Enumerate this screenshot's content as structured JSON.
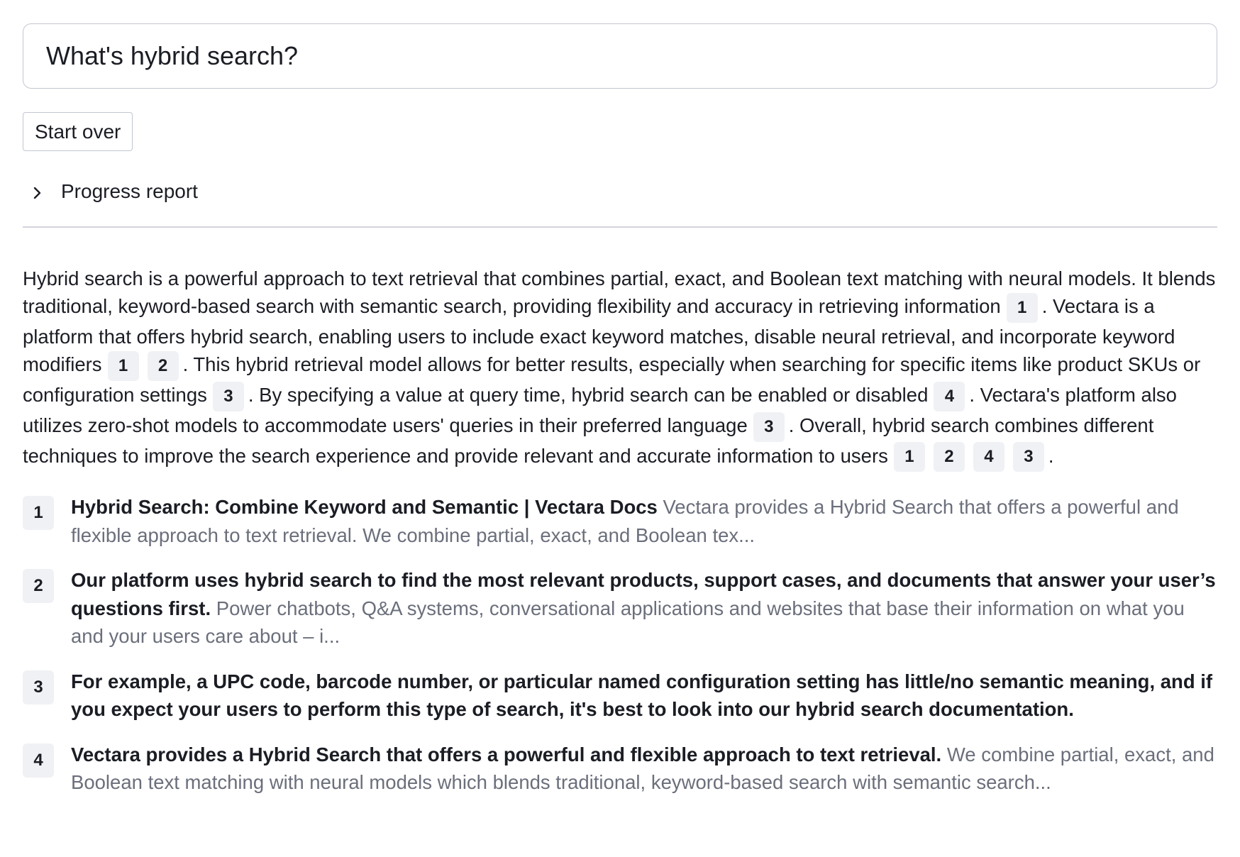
{
  "search": {
    "value": "What's hybrid search?"
  },
  "controls": {
    "start_over_label": "Start over",
    "progress_label": "Progress report",
    "progress_icon": "chevron-right-icon"
  },
  "summary": {
    "p1": "Hybrid search is a powerful approach to text retrieval that combines partial, exact, and Boolean text matching with neural models. It blends traditional, keyword-based search with semantic search, providing flexibility and accuracy in retrieving information",
    "c1": "1",
    "p2": ". Vectara is a platform that offers hybrid search, enabling users to include exact keyword matches, disable neural retrieval, and incorporate keyword modifiers",
    "c2a": "1",
    "c2b": "2",
    "p3": ". This hybrid retrieval model allows for better results, especially when searching for specific items like product SKUs or configuration settings",
    "c3": "3",
    "p4": ". By specifying a value at query time, hybrid search can be enabled or disabled",
    "c4": "4",
    "p5": ". Vectara's platform also utilizes zero-shot models to accommodate users' queries in their preferred language",
    "c5": "3",
    "p6": ". Overall, hybrid search combines different techniques to improve the search experience and provide relevant and accurate information to users",
    "c6a": "1",
    "c6b": "2",
    "c6c": "4",
    "c6d": "3",
    "p7": "."
  },
  "references": [
    {
      "number": "1",
      "title": "Hybrid Search: Combine Keyword and Semantic | Vectara Docs",
      "snippet": "Vectara provides a Hybrid Search that offers a powerful and flexible approach to text retrieval. We combine partial, exact, and Boolean tex..."
    },
    {
      "number": "2",
      "title": "Our platform uses hybrid search to find the most relevant products, support cases, and documents that answer your user’s questions first.",
      "snippet": "Power chatbots, Q&A systems, conversational applications and websites that base their information on what you and your users care about – i..."
    },
    {
      "number": "3",
      "title": "For example, a UPC code, barcode number, or particular named configuration setting has little/no semantic meaning, and if you expect your users to perform this type of search, it's best to look into our hybrid search documentation.",
      "snippet": ""
    },
    {
      "number": "4",
      "title": "Vectara provides a Hybrid Search that offers a powerful and flexible approach to text retrieval.",
      "snippet": "We combine partial, exact, and Boolean text matching with neural models which blends traditional, keyword-based search with semantic search..."
    }
  ]
}
